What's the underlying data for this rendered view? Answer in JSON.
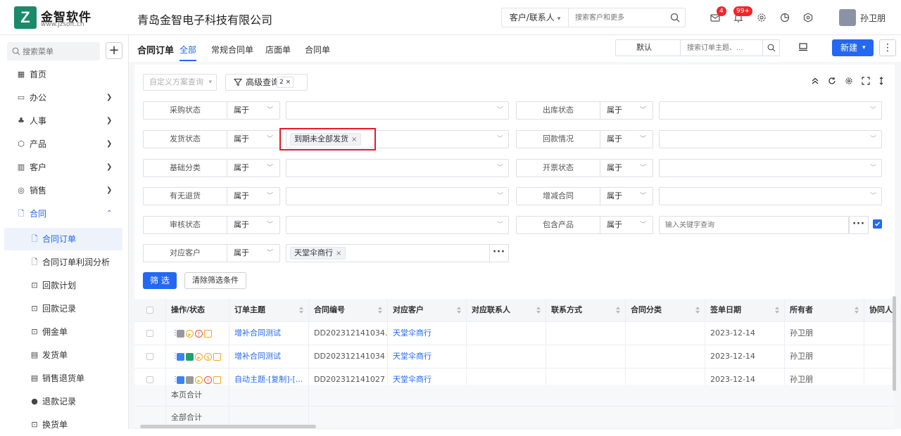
{
  "app": {
    "logo_name": "金智软件",
    "logo_url": "www.jzsoft.cn",
    "company": "青岛金智电子科技有限公司",
    "search_scope": "客户/联系人",
    "search_placeholder": "搜索客户和更多",
    "mail_badge": "4",
    "bell_badge": "99+",
    "username": "孙卫朋"
  },
  "sidebar": {
    "search_placeholder": "搜索菜单",
    "items": [
      {
        "label": "首页",
        "icon": "home-icon"
      },
      {
        "label": "办公",
        "icon": "office-icon"
      },
      {
        "label": "人事",
        "icon": "personnel-icon"
      },
      {
        "label": "产品",
        "icon": "product-icon"
      },
      {
        "label": "客户",
        "icon": "customer-icon"
      },
      {
        "label": "销售",
        "icon": "sales-icon"
      },
      {
        "label": "合同",
        "icon": "contract-icon"
      }
    ],
    "subitems": [
      {
        "label": "合同订单"
      },
      {
        "label": "合同订单利润分析"
      },
      {
        "label": "回款计划"
      },
      {
        "label": "回款记录"
      },
      {
        "label": "佣金单"
      },
      {
        "label": "发货单"
      },
      {
        "label": "销售退货单"
      },
      {
        "label": "退款记录"
      },
      {
        "label": "换货单"
      }
    ]
  },
  "header": {
    "title": "合同订单",
    "tabs": [
      "全部",
      "常规合同单",
      "店面单",
      "合同单"
    ],
    "view_select": "默认",
    "search_placeholder": "搜索订单主题、...",
    "new_label": "新建"
  },
  "filters": {
    "custom_query_placeholder": "自定义方案查询",
    "advanced_query": "高级查询",
    "advanced_count": "2",
    "rows": [
      {
        "label": "采购状态",
        "op": "属于",
        "tag": ""
      },
      {
        "label": "出库状态",
        "op": "属于",
        "tag": ""
      },
      {
        "label": "发货状态",
        "op": "属于",
        "tag": "到期未全部发货"
      },
      {
        "label": "回款情况",
        "op": "属于",
        "tag": ""
      },
      {
        "label": "基础分类",
        "op": "属于",
        "tag": ""
      },
      {
        "label": "开票状态",
        "op": "属于",
        "tag": ""
      },
      {
        "label": "有无退货",
        "op": "属于",
        "tag": ""
      },
      {
        "label": "增减合同",
        "op": "属于",
        "tag": ""
      },
      {
        "label": "审核状态",
        "op": "属于",
        "tag": ""
      },
      {
        "label": "包含产品",
        "op": "属于",
        "placeholder": "输入关键字查询"
      },
      {
        "label": "对应客户",
        "op": "属于",
        "tag": "天堂伞商行"
      }
    ],
    "filter_btn": "筛 选",
    "clear_btn": "清除筛选条件"
  },
  "table": {
    "columns": [
      "操作/状态",
      "订单主题",
      "合同编号",
      "对应客户",
      "对应联系人",
      "联系方式",
      "合同分类",
      "签单日期",
      "所有者",
      "协同人"
    ],
    "rows": [
      {
        "subject": "增补合同测试",
        "code": "DD202312141034...",
        "customer": "天堂伞商行",
        "date": "2023-12-14",
        "owner": "孙卫朋"
      },
      {
        "subject": "增补合同测试",
        "code": "DD202312141034",
        "customer": "天堂伞商行",
        "date": "2023-12-14",
        "owner": "孙卫朋"
      },
      {
        "subject": "自动主题-[复制]-[...",
        "code": "DD202312141027",
        "customer": "天堂伞商行",
        "date": "2023-12-14",
        "owner": "孙卫朋"
      }
    ],
    "page_total": "本页合计",
    "all_total": "全部合计"
  },
  "colors": {
    "accent": "#2468f2",
    "highlight": "#e6192b",
    "badge": "#f5222d"
  }
}
